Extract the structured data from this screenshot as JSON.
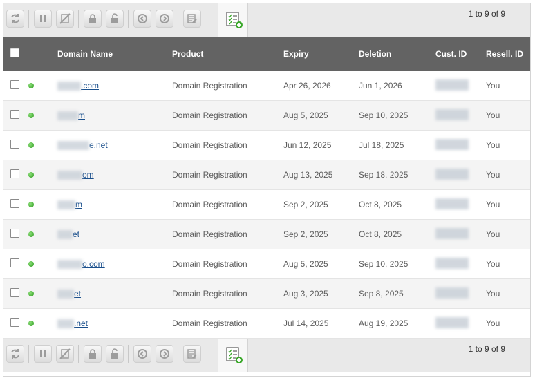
{
  "pager_text": "1 to 9 of 9",
  "toolbar_icons": [
    "refresh-icon",
    "pause-icon",
    "cancel-icon",
    "lock-icon",
    "unlock-icon",
    "transfer-in-icon",
    "transfer-out-icon",
    "edit-list-icon",
    "add-list-icon"
  ],
  "columns": {
    "domain": "Domain Name",
    "product": "Product",
    "expiry": "Expiry",
    "deletion": "Deletion",
    "cust_id": "Cust. ID",
    "resell_id": "Resell. ID"
  },
  "rows": [
    {
      "domain": ".com",
      "product": "Domain Registration",
      "expiry": "Apr 26, 2026",
      "deletion": "Jun 1, 2026",
      "resell": "You"
    },
    {
      "domain": "m",
      "product": "Domain Registration",
      "expiry": "Aug 5, 2025",
      "deletion": "Sep 10, 2025",
      "resell": "You"
    },
    {
      "domain": "e.net",
      "product": "Domain Registration",
      "expiry": "Jun 12, 2025",
      "deletion": "Jul 18, 2025",
      "resell": "You"
    },
    {
      "domain": "om",
      "product": "Domain Registration",
      "expiry": "Aug 13, 2025",
      "deletion": "Sep 18, 2025",
      "resell": "You"
    },
    {
      "domain": "m",
      "product": "Domain Registration",
      "expiry": "Sep 2, 2025",
      "deletion": "Oct 8, 2025",
      "resell": "You"
    },
    {
      "domain": "et",
      "product": "Domain Registration",
      "expiry": "Sep 2, 2025",
      "deletion": "Oct 8, 2025",
      "resell": "You"
    },
    {
      "domain": "o.com",
      "product": "Domain Registration",
      "expiry": "Aug 5, 2025",
      "deletion": "Sep 10, 2025",
      "resell": "You"
    },
    {
      "domain": "et",
      "product": "Domain Registration",
      "expiry": "Aug 3, 2025",
      "deletion": "Sep 8, 2025",
      "resell": "You"
    },
    {
      "domain": ".net",
      "product": "Domain Registration",
      "expiry": "Jul 14, 2025",
      "deletion": "Aug 19, 2025",
      "resell": "You"
    }
  ],
  "colors": {
    "header_bg": "#636363",
    "toolbar_bg": "#e9e9e9",
    "status_active": "#3aa82a",
    "link": "#1a4f8c"
  }
}
